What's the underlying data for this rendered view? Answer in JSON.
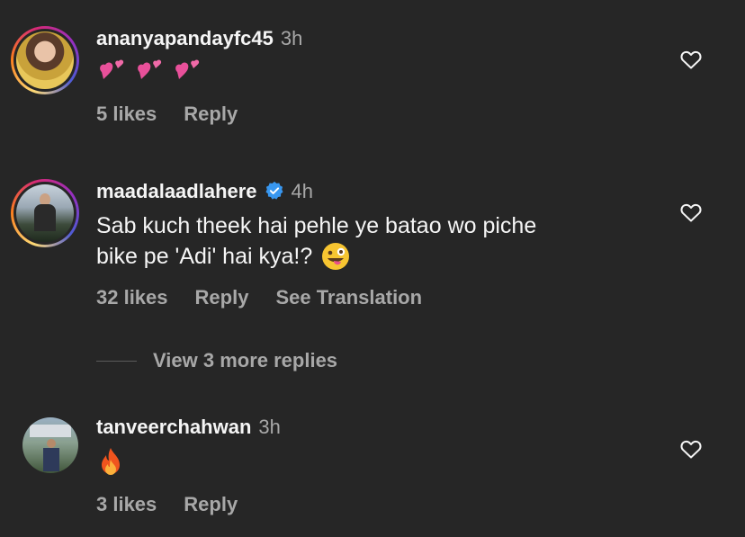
{
  "comments": [
    {
      "username": "ananyapandayfc45",
      "time": "3h",
      "body_emoji": [
        "revolving-hearts",
        "revolving-hearts",
        "revolving-hearts"
      ],
      "likes": "5 likes",
      "reply": "Reply"
    },
    {
      "username": "maadalaadlahere",
      "verified": true,
      "time": "4h",
      "body_line1": "Sab kuch theek hai pehle ye batao wo piche",
      "body_line2": "bike pe 'Adi' hai kya!?",
      "body_emoji": "winking-face-with-tongue",
      "likes": "32 likes",
      "reply": "Reply",
      "translate": "See Translation"
    },
    {
      "username": "tanveerchahwan",
      "time": "3h",
      "body_emoji": "fire",
      "likes": "3 likes",
      "reply": "Reply"
    }
  ],
  "view_more": "View 3 more replies",
  "colors": {
    "background": "#262626",
    "primary_text": "#f5f5f5",
    "secondary_text": "#a8a8a8",
    "verified_blue": "#3897f0"
  },
  "icons": [
    "heart-outline-icon",
    "verified-badge-icon"
  ]
}
